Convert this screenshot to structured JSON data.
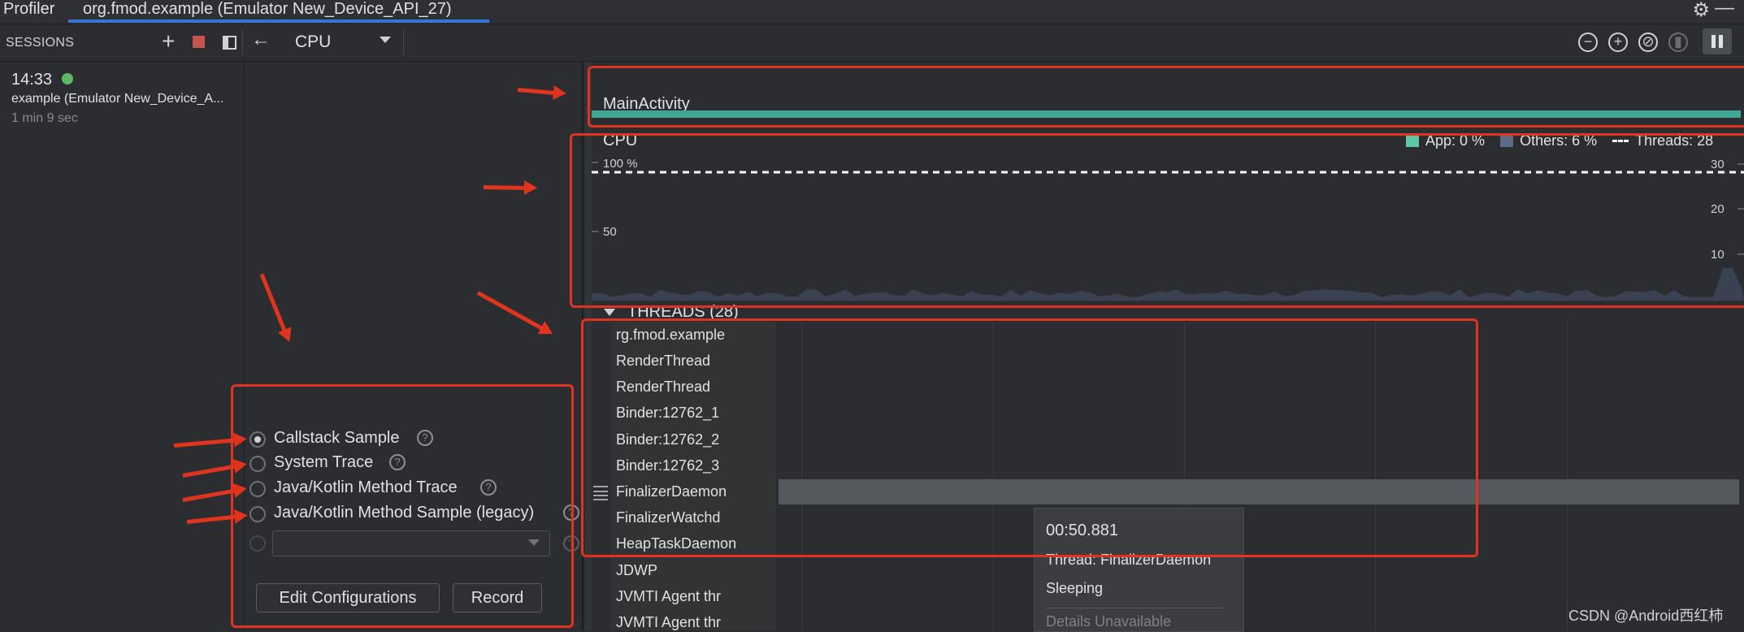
{
  "tabs": {
    "profiler": "Profiler",
    "app": "org.fmod.example (Emulator New_Device_API_27)"
  },
  "toolbar": {
    "sessions_label": "SESSIONS",
    "cpu_select": "CPU"
  },
  "session": {
    "time": "14:33",
    "name": "example (Emulator New_Device_A...",
    "duration": "1 min 9 sec"
  },
  "config": {
    "options": [
      {
        "label": "Callstack Sample",
        "checked": true
      },
      {
        "label": "System Trace",
        "checked": false
      },
      {
        "label": "Java/Kotlin Method Trace",
        "checked": false
      },
      {
        "label": "Java/Kotlin Method Sample (legacy)",
        "checked": false
      }
    ],
    "help_glyph": "?",
    "edit_configurations": "Edit Configurations",
    "record": "Record"
  },
  "activity": {
    "label": "MainActivity"
  },
  "cpu": {
    "title": "CPU",
    "legend": {
      "app": "App: 0 %",
      "others": "Others: 6 %",
      "threads": "Threads: 28"
    },
    "left_axis": {
      "top": "100 %",
      "mid": "50"
    },
    "right_axis": {
      "top": "30",
      "mid": "20",
      "low": "10"
    }
  },
  "threads": {
    "header": "THREADS (28)",
    "items": [
      "rg.fmod.example",
      "RenderThread",
      "RenderThread",
      "Binder:12762_1",
      "Binder:12762_2",
      "Binder:12762_3",
      "FinalizerDaemon",
      "FinalizerWatchd",
      "HeapTaskDaemon",
      "JDWP",
      "JVMTI Agent thr",
      "JVMTI Agent thr"
    ]
  },
  "tooltip": {
    "time": "00:50.881",
    "thread": "Thread: FinalizerDaemon",
    "state": "Sleeping",
    "details": "Details Unavailable"
  },
  "watermark": "CSDN @Android西红柿",
  "colors": {
    "app": "#5fc7a8",
    "others": "#5c6a85",
    "accent": "#3874d8",
    "annotation": "#e0341f"
  }
}
